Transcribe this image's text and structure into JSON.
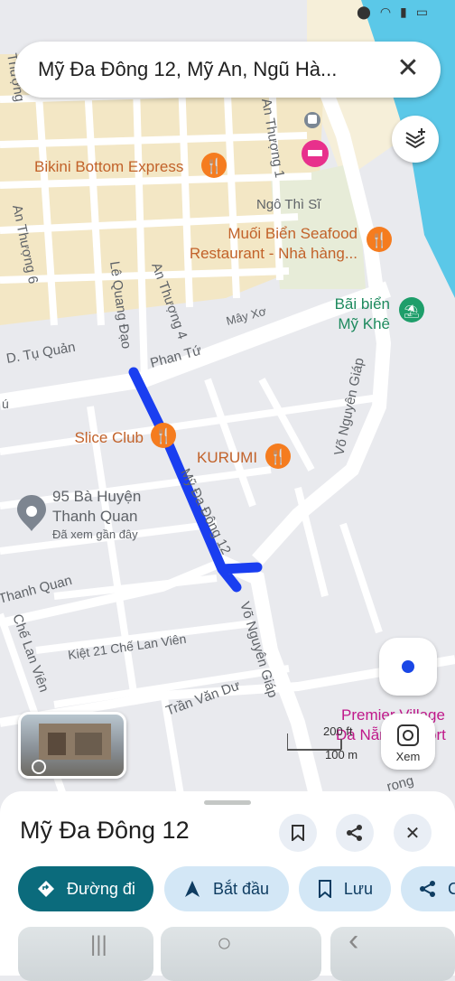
{
  "colors": {
    "route": "#1a3ef0",
    "food_pin": "#f57c1f",
    "hotel_pin": "#e8308c",
    "park_pin": "#1e9e6a",
    "accent": "#0b6b7c",
    "chip": "#d3e7f6",
    "water": "#5bc8e8",
    "sand": "#f6efd9",
    "road": "#ffffff",
    "block": "#e9eaee",
    "poi_pink": "#c0188a"
  },
  "search": {
    "query": "Mỹ Đa Đông 12, Mỹ An, Ngũ Hà...",
    "close_icon": "close-icon"
  },
  "map": {
    "streets": [
      "Thượng",
      "An Thượng 1",
      "Ngô Thì Sĩ",
      "An Thượng 6",
      "Lê Quang Đạo",
      "An Thượng 4",
      "Mây Xơ",
      "D. Tụ Quản",
      "Phan Tứ",
      "Võ Nguyên Giáp",
      "Mỹ Đa Đông 12",
      "Thanh Quan",
      "Chế Lan Viên",
      "Kiệt 21 Chế Lan Viên",
      "Trần Văn Dư",
      "Võ Nguyên Giáp",
      "rong",
      "ú"
    ],
    "pois": [
      {
        "name": "Bikini Bottom Express",
        "icon": "restaurant-icon"
      },
      {
        "name": "Muối Biển Seafood",
        "name2": "Restaurant - Nhà hàng...",
        "icon": "restaurant-icon"
      },
      {
        "name": "Bãi biển",
        "name2": "Mỹ Khê",
        "icon": "beach-icon"
      },
      {
        "name": "Slice Club",
        "icon": "restaurant-icon"
      },
      {
        "name": "KURUMI",
        "icon": "restaurant-icon"
      },
      {
        "name": "95 Bà Huyện",
        "name2": "Thanh Quan",
        "name3": "Đã xem gần đây",
        "icon": "place-pin-icon"
      },
      {
        "name": "Premier Village",
        "name2": "Đà Nẵng Resort",
        "icon": "hotel-icon"
      }
    ],
    "scale": {
      "label1": "200 ft",
      "label2": "100 m"
    }
  },
  "buttons": {
    "lens_label": "Xem"
  },
  "place": {
    "title": "Mỹ Đa Đông 12",
    "actions": [
      {
        "label": "Đường đi",
        "icon": "directions-icon"
      },
      {
        "label": "Bắt đầu",
        "icon": "navigation-arrow-icon"
      },
      {
        "label": "Lưu",
        "icon": "bookmark-icon"
      },
      {
        "label": "C",
        "icon": "share-icon"
      }
    ]
  },
  "navbar": {
    "recents": "|||",
    "home": "○",
    "back": "‹"
  }
}
